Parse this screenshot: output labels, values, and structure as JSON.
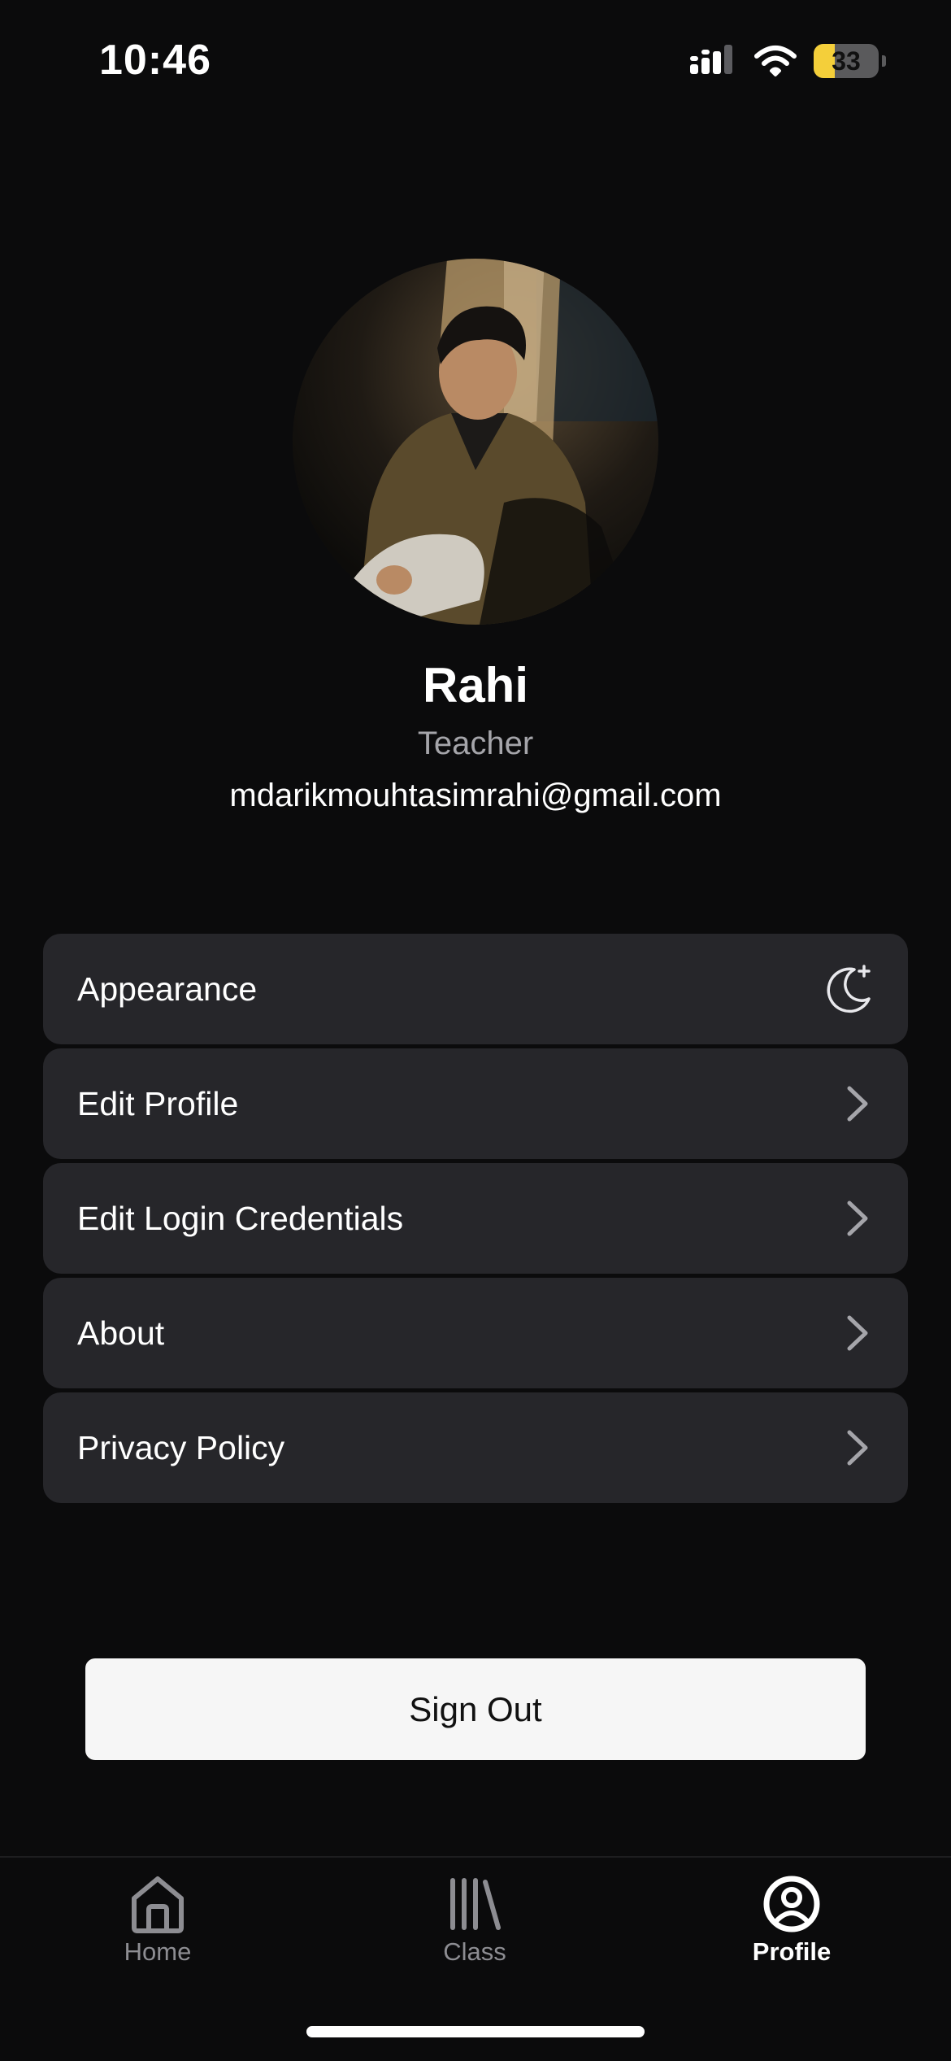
{
  "status_bar": {
    "time": "10:46",
    "battery_level": "33",
    "battery_fraction": 0.33,
    "icons": [
      "cellular-signal-icon",
      "wifi-icon",
      "battery-icon"
    ]
  },
  "profile": {
    "name": "Rahi",
    "role": "Teacher",
    "email": "mdarikmouhtasimrahi@gmail.com"
  },
  "menu": {
    "items": [
      {
        "label": "Appearance",
        "icon": "moon-icon"
      },
      {
        "label": "Edit Profile",
        "icon": "chevron-right-icon"
      },
      {
        "label": "Edit Login Credentials",
        "icon": "chevron-right-icon"
      },
      {
        "label": "About",
        "icon": "chevron-right-icon"
      },
      {
        "label": "Privacy Policy",
        "icon": "chevron-right-icon"
      }
    ]
  },
  "sign_out_label": "Sign Out",
  "tab_bar": {
    "tabs": [
      {
        "label": "Home",
        "icon": "home-icon",
        "active": false
      },
      {
        "label": "Class",
        "icon": "library-icon",
        "active": false
      },
      {
        "label": "Profile",
        "icon": "person-circle-icon",
        "active": true
      }
    ]
  },
  "colors": {
    "background": "#0b0b0c",
    "card": "#26262a",
    "secondary_text": "#a5a5aa",
    "inactive_tab": "#8d8d92",
    "battery": "#f4cf3a"
  }
}
